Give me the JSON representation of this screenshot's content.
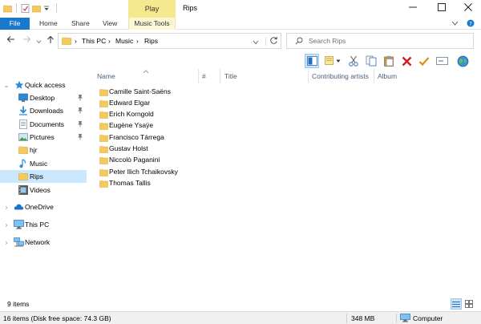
{
  "window": {
    "title": "Rips",
    "context_tab": "Play"
  },
  "ribbon": {
    "tabs": [
      {
        "label": "File"
      },
      {
        "label": "Home"
      },
      {
        "label": "Share"
      },
      {
        "label": "View"
      },
      {
        "label": "Music Tools"
      }
    ]
  },
  "address": {
    "segments": [
      "This PC",
      "Music",
      "Rips"
    ]
  },
  "search": {
    "placeholder": "Search Rips"
  },
  "columns": [
    "Name",
    "#",
    "Title",
    "Contributing artists",
    "Album"
  ],
  "nav": {
    "items": [
      {
        "label": "Quick access",
        "icon": "star-icon"
      },
      {
        "label": "Desktop",
        "icon": "desktop-icon",
        "pinned": true
      },
      {
        "label": "Downloads",
        "icon": "download-icon",
        "pinned": true
      },
      {
        "label": "Documents",
        "icon": "documents-icon",
        "pinned": true
      },
      {
        "label": "Pictures",
        "icon": "pictures-icon",
        "pinned": true
      },
      {
        "label": "hjr",
        "icon": "folder-icon"
      },
      {
        "label": "Music",
        "icon": "music-icon"
      },
      {
        "label": "Rips",
        "icon": "folder-icon",
        "selected": true
      },
      {
        "label": "Videos",
        "icon": "videos-icon"
      },
      {
        "label": "OneDrive",
        "icon": "cloud-icon"
      },
      {
        "label": "This PC",
        "icon": "computer-icon"
      },
      {
        "label": "Network",
        "icon": "network-icon"
      }
    ]
  },
  "files": [
    "Camille Saint-Saëns",
    "Edward Elgar",
    "Erich Korngold",
    "Eugène Ysaÿe",
    "Francisco Tárrega",
    "Gustav Holst",
    "Niccolò Paganini",
    "Peter Ilich Tchaikovsky",
    "Thomas Tallis"
  ],
  "status": {
    "item_count": "9 items",
    "disk_info": "16 items (Disk free space: 74.3 GB)",
    "size": "348 MB",
    "location": "Computer"
  },
  "colors": {
    "accent": "#1979ca",
    "selection": "#cce8ff",
    "folder": "#f5c95b",
    "context_tab": "#f5e88f"
  }
}
